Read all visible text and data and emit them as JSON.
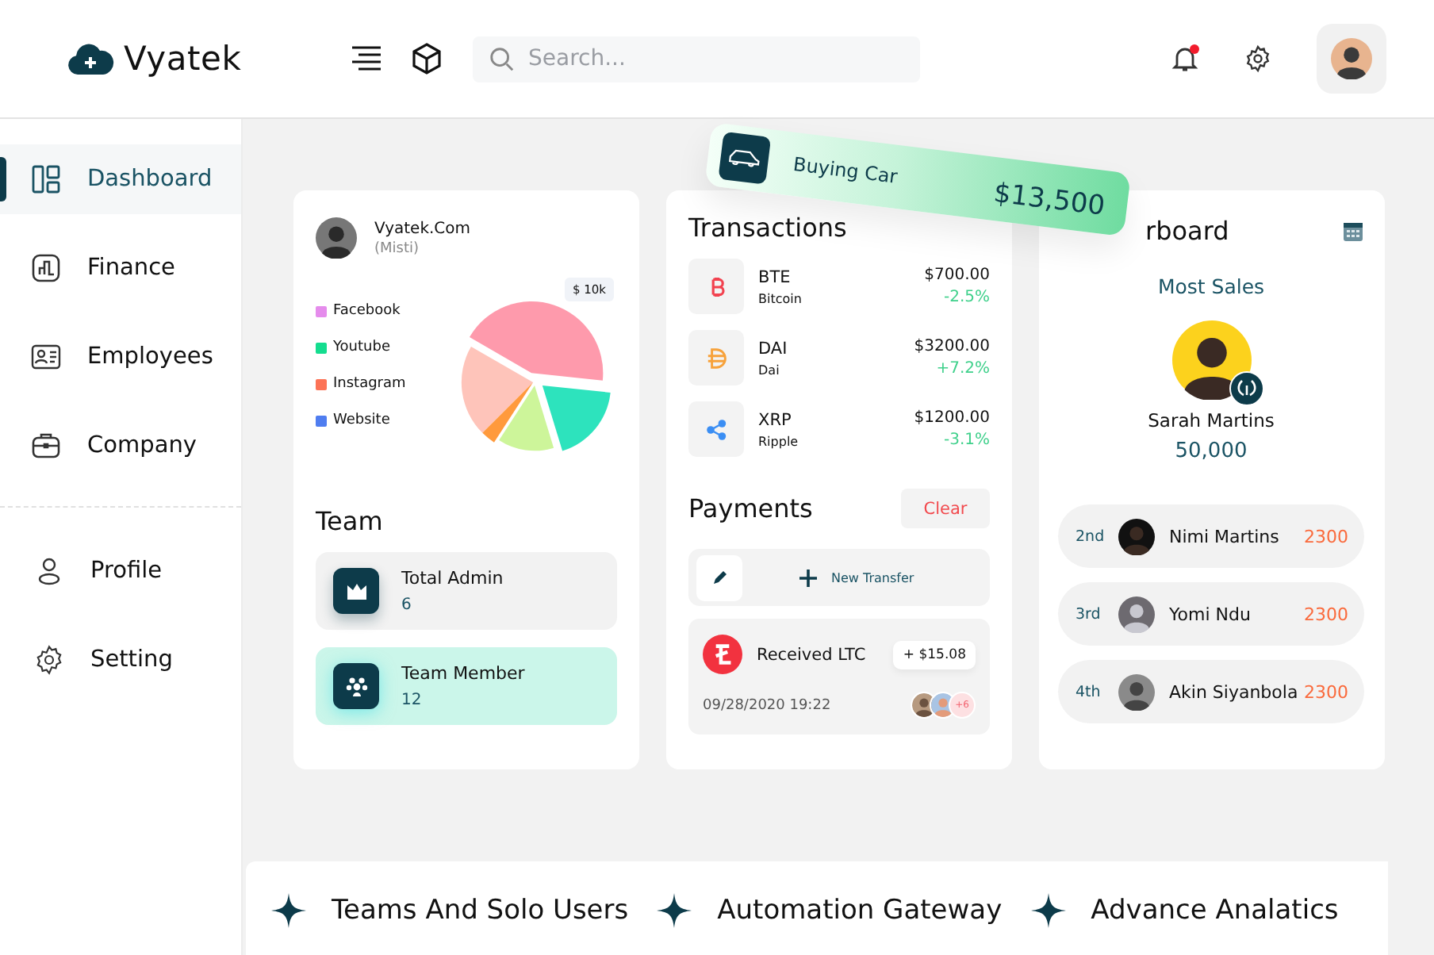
{
  "app": {
    "brand": "Vyatek",
    "search": {
      "placeholder": "Search..."
    },
    "notifications": {
      "unread": true
    }
  },
  "sidebar": {
    "items": [
      {
        "label": "Dashboard",
        "kind": "dashboard",
        "selected": true
      },
      {
        "label": "Finance",
        "kind": "finance",
        "selected": false
      },
      {
        "label": "Employees",
        "kind": "employees",
        "selected": false
      },
      {
        "label": "Company",
        "kind": "company",
        "selected": false
      }
    ],
    "bottom_items": [
      {
        "label": "Profile",
        "kind": "profile",
        "selected": false
      },
      {
        "label": "Setting",
        "kind": "settings",
        "selected": false
      }
    ]
  },
  "float_card": {
    "title": "Buying Car",
    "amount": "$13,500"
  },
  "social_card": {
    "account": {
      "name": "Vyatek.Com",
      "handle": "(Misti)"
    },
    "badge": "$ 10k",
    "legend": [
      {
        "label": "Facebook",
        "color": "#e58cec"
      },
      {
        "label": "Youtube",
        "color": "#14dd8f"
      },
      {
        "label": "Instagram",
        "color": "#fc7356"
      },
      {
        "label": "Website",
        "color": "#4f7df0"
      }
    ]
  },
  "team": {
    "title": "Team",
    "items": [
      {
        "kind": "admin",
        "label": "Total Admin",
        "count": "6",
        "selected": false
      },
      {
        "kind": "member",
        "label": "Team Member",
        "count": "12",
        "selected": true
      }
    ]
  },
  "transactions": {
    "title": "Transactions",
    "items": [
      {
        "kind": "btc",
        "symbol": "BTE",
        "name": "Bitcoin",
        "amount": "$700.00",
        "change": "-2.5%"
      },
      {
        "kind": "dai",
        "symbol": "DAI",
        "name": "Dai",
        "amount": "$3200.00",
        "change": "+7.2%"
      },
      {
        "kind": "xrp",
        "symbol": "XRP",
        "name": "Ripple",
        "amount": "$1200.00",
        "change": "-3.1%"
      }
    ]
  },
  "payments": {
    "title": "Payments",
    "clear_label": "Clear",
    "new_transfer_label": "New Transfer",
    "received": {
      "kind": "ltc",
      "title": "Received LTC",
      "amount": "+ $15.08",
      "datetime": "09/28/2020 19:22",
      "more": "+6"
    }
  },
  "leaderboard": {
    "title": "rboard",
    "subtitle": "Most Sales",
    "top": {
      "name": "Sarah Martins",
      "score": "50,000"
    },
    "rows": [
      {
        "rank": "2nd",
        "name": "Nimi Martins",
        "score": "2300"
      },
      {
        "rank": "3rd",
        "name": "Yomi Ndu",
        "score": "2300"
      },
      {
        "rank": "4th",
        "name": "Akin Siyanbola",
        "score": "2300"
      }
    ]
  },
  "features": [
    {
      "label": "Teams And Solo Users"
    },
    {
      "label": "Automation Gateway"
    },
    {
      "label": "Advance Analatics"
    }
  ]
}
